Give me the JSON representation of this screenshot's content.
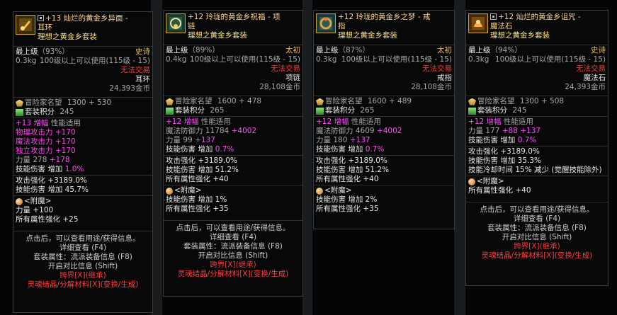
{
  "p1": {
    "title_a": "+13 灿烂的黄金乡异面 -",
    "title_b": "耳环",
    "set": "理想之黄金乡套装",
    "grade_label": "最上级",
    "grade_pct": "（93%）",
    "rarity": "史诗",
    "weight": "0.3kg",
    "level_req": "100级以上可以使用(115级 - 15)",
    "trade": "无法交易",
    "slot": "耳环",
    "price": "24,393金币",
    "rep_label": "冒险家名望",
    "rep_value": "1300 + 530",
    "setpt_label": "套装积分",
    "setpt_value": "245",
    "amp_label": "+13 增幅",
    "amp_desc": "性能适用",
    "atk1": "物理攻击力 +170",
    "atk2": "魔法攻击力 +170",
    "atk3": "独立攻击力 +170",
    "str_label": "力量 278",
    "str_bonus": "+178",
    "skill_label": "技能伤害  增加",
    "skill_val": "1.0%",
    "atkup": "攻击强化 +3189.0%",
    "skill2": "技能伤害  增加 45.7%",
    "ench_title": "<附魔>",
    "ench1": "力量 +100",
    "ench2": "所有属性强化 +25",
    "b1": "点击后，可以查看用途/获得信息。",
    "b2": "详细查看 (F4)",
    "b3": "套装属性：流派装备信息 (F8)",
    "b4": "开启对比信息 (Shift)",
    "b5": "跨界[X](继承)",
    "b6": "灵魂结晶/分解材料[X](变换/生成)"
  },
  "p2": {
    "title_a": "+12 玲珑的黄金乡祝福 - 项",
    "title_b": "链",
    "set": "理想之黄金乡套装",
    "grade_label": "最上级",
    "grade_pct": "（89%）",
    "rarity": "太初",
    "weight": "0.4kg",
    "level_req": "100级以上可以使用(115级 - 15)",
    "trade": "无法交易",
    "slot": "项链",
    "price": "28,108金币",
    "rep_label": "冒险家名望",
    "rep_value": "1600 + 478",
    "setpt_label": "套装积分",
    "setpt_value": "265",
    "amp_label": "+12 增幅",
    "amp_desc": "性能适用",
    "def_label": "魔法防御力 11784",
    "def_bonus": "+4002",
    "str_label": "力量 99",
    "str_bonus": "+137",
    "skill_label": "技能伤害  增加",
    "skill_val": "0.7%",
    "atkup": "攻击强化 +3189.0%",
    "skill2": "技能伤害  增加 51.2%",
    "allstat": "所有属性强化 +40",
    "ench_title": "<附魔>",
    "ench1": "技能伤害  增加 1%",
    "ench2": "所有属性强化 +35",
    "b1": "点击后，可以查看用途/获得信息。",
    "b2": "详细查看 (F4)",
    "b3": "套装属性：流派装备信息 (F8)",
    "b4": "开启对比信息 (Shift)",
    "b5": "跨界[X](继承)",
    "b6": "灵魂结晶/分解材料[X](变换/生成)"
  },
  "p3": {
    "title_a": "+12 玲珑的黄金乡之梦 - 戒",
    "title_b": "指",
    "set": "理想之黄金乡套装",
    "grade_label": "最上级",
    "grade_pct": "（87%）",
    "rarity": "太初",
    "weight": "0.3kg",
    "level_req": "100级以上可以使用(115级 - 15)",
    "trade": "无法交易",
    "slot": "戒指",
    "price": "28,108金币",
    "rep_label": "冒险家名望",
    "rep_value": "1600 + 489",
    "setpt_label": "套装积分",
    "setpt_value": "265",
    "amp_label": "+12 增幅",
    "amp_desc": "性能适用",
    "def_label": "魔法防御力 4609",
    "def_bonus": "+4002",
    "str_label": "力量 180",
    "str_bonus": "+137",
    "skill_label": "技能伤害  增加",
    "skill_val": "0.7%",
    "atkup": "攻击强化 +3189.0%",
    "skill2": "技能伤害  增加 51.2%",
    "allstat": "所有属性强化 +40",
    "ench_title": "<附魔>",
    "ench1": "技能伤害  增加 2%",
    "ench2": "所有属性强化 +35"
  },
  "p4": {
    "title_a": "+12 灿烂的黄金乡诅咒 -",
    "title_b": "魔法石",
    "set": "理想之黄金乡套装",
    "grade_label": "最上级",
    "grade_pct": "（94%）",
    "rarity": "史诗",
    "weight": "0.3kg",
    "level_req": "100级以上可以使用(115级 - 15)",
    "trade": "无法交易",
    "slot": "魔法石",
    "price": "24,393金币",
    "rep_label": "冒险家名望",
    "rep_value": "1300 + 508",
    "setpt_label": "套装积分",
    "setpt_value": "245",
    "amp_label": "+12 增幅",
    "amp_desc": "性能适用",
    "str_label": "力量 177",
    "str_bonus": "+88 +137",
    "skill_label": "技能伤害  增加",
    "skill_val": "0.7%",
    "atkup": "攻击强化 +3189.0%",
    "skill2": "技能伤害  增加 35.3%",
    "cd": "技能冷却时间 15% 减少 (觉醒技能除外)",
    "ench_title": "<附魔>",
    "ench1": "所有属性强化 +40",
    "b1": "点击后，可以查看用途/获得信息。",
    "b2": "详细查看 (F4)",
    "b3": "套装属性：流派装备信息 (F8)",
    "b4": "开启对比信息 (Shift)",
    "b5": "跨界[X](继承)",
    "b6": "灵魂结晶/分解材料[X](变换/生成)"
  },
  "colors": {
    "title": "#ffd38a",
    "set": "#ffe07a",
    "red": "#ff3c3c",
    "pink": "#ff4cff",
    "border": "#c9a23a"
  }
}
